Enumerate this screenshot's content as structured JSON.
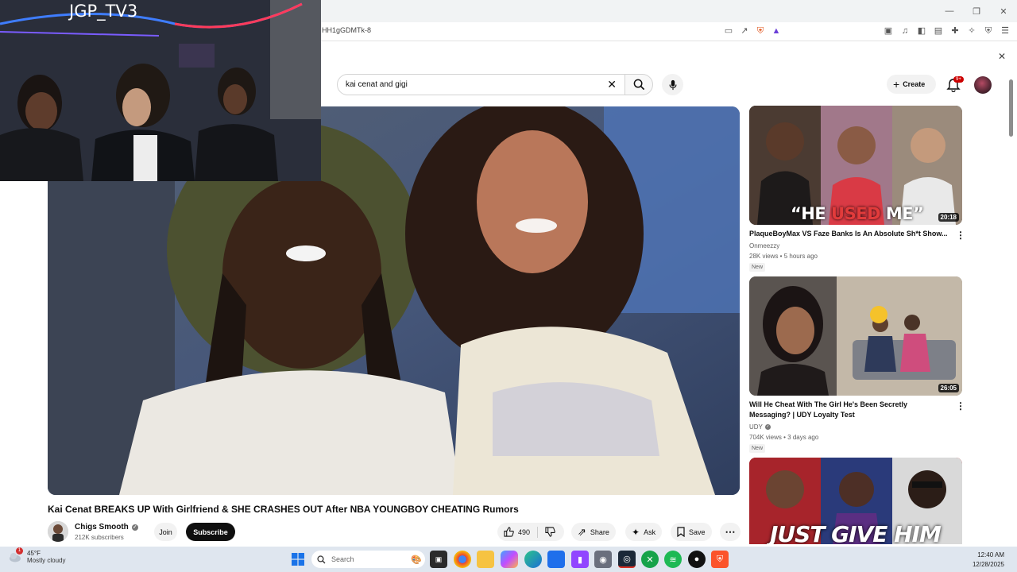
{
  "browser": {
    "url": "HH1gGDMTk-8",
    "window_controls": [
      "—",
      "❐",
      "✕"
    ]
  },
  "search": {
    "value": "kai cenat and gigi"
  },
  "header": {
    "create_label": "Create",
    "notification_badge": "9+"
  },
  "video": {
    "title": "Kai Cenat BREAKS UP With Girlfriend & SHE CRASHES OUT After NBA YOUNGBOY CHEATING Rumors",
    "channel": "Chigs Smooth",
    "subscribers": "212K subscribers",
    "join_label": "Join",
    "subscribe_label": "Subscribe",
    "likes": "490",
    "share_label": "Share",
    "ask_label": "Ask",
    "save_label": "Save"
  },
  "recommendations": [
    {
      "title": "PlaqueBoyMax VS Faze Banks Is An Absolute Sh*t Show...",
      "thumb_caption_a": "“HE ",
      "thumb_caption_b": "USED",
      "thumb_caption_c": " ME”",
      "duration": "20:18",
      "channel": "Onmeezzy",
      "meta": "28K views • 5 hours ago",
      "badge": "New"
    },
    {
      "title": "Will He Cheat With The Girl He's Been Secretly Messaging? | UDY Loyalty Test",
      "duration": "26:05",
      "channel": "UDY",
      "meta": "704K views • 3 days ago",
      "badge": "New"
    },
    {
      "thumb_caption": "JUST GIVE HIM"
    }
  ],
  "webcam": {
    "label": "JGP_TV3"
  },
  "taskbar": {
    "temperature": "45°F",
    "weather": "Mostly cloudy",
    "search_placeholder": "Search",
    "time": "12:40 AM",
    "date": "12/28/2025",
    "weather_alert": "1"
  },
  "colors": {
    "youtube_red": "#cc0000",
    "subscribe_bg": "#0f0f0f",
    "taskbar_bg": "#dfe6ef",
    "chip_bg": "#f2f2f2"
  },
  "icons": [
    "search-icon",
    "clear-icon",
    "mic-icon",
    "plus-icon",
    "bell-icon",
    "like-icon",
    "dislike-icon",
    "share-icon",
    "sparkle-icon",
    "bookmark-icon",
    "more-icon",
    "windows-icon",
    "verified-icon"
  ]
}
